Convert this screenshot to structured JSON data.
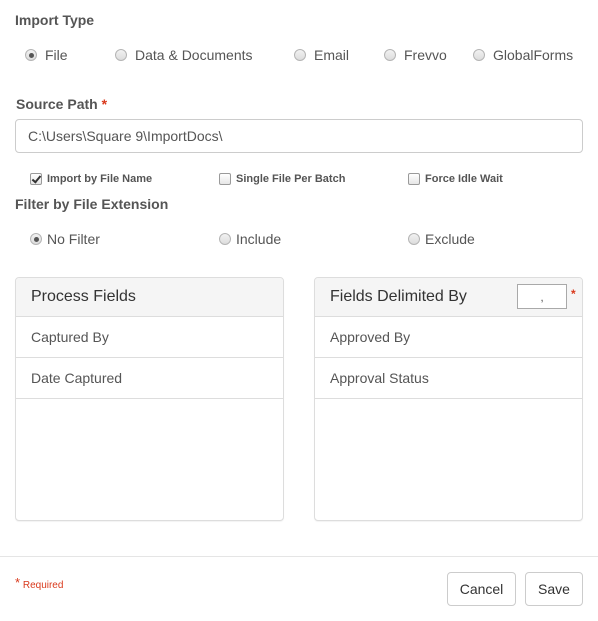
{
  "import_type": {
    "label": "Import Type",
    "options": [
      {
        "label": "File",
        "checked": true
      },
      {
        "label": "Data & Documents",
        "checked": false
      },
      {
        "label": "Email",
        "checked": false
      },
      {
        "label": "Frevvo",
        "checked": false
      },
      {
        "label": "GlobalForms",
        "checked": false
      }
    ]
  },
  "source_path": {
    "label": "Source Path",
    "required_marker": "*",
    "value": "C:\\Users\\Square 9\\ImportDocs\\"
  },
  "options": [
    {
      "label": "Import by File Name",
      "checked": true
    },
    {
      "label": "Single File Per Batch",
      "checked": false
    },
    {
      "label": "Force Idle Wait",
      "checked": false
    }
  ],
  "filter": {
    "label": "Filter by File Extension",
    "options": [
      {
        "label": "No Filter",
        "checked": true
      },
      {
        "label": "Include",
        "checked": false
      },
      {
        "label": "Exclude",
        "checked": false
      }
    ]
  },
  "process_fields": {
    "title": "Process Fields",
    "items": [
      "Captured By",
      "Date Captured"
    ]
  },
  "delimited_fields": {
    "title": "Fields Delimited By",
    "delimiter_value": ",",
    "required_marker": "*",
    "items": [
      "Approved By",
      "Approval Status"
    ]
  },
  "footer": {
    "required_marker": "*",
    "required_text": "Required",
    "cancel_label": "Cancel",
    "save_label": "Save"
  },
  "colors": {
    "required": "#d9391c",
    "panel_heading_bg": "#f5f5f5",
    "border": "#dddddd"
  }
}
